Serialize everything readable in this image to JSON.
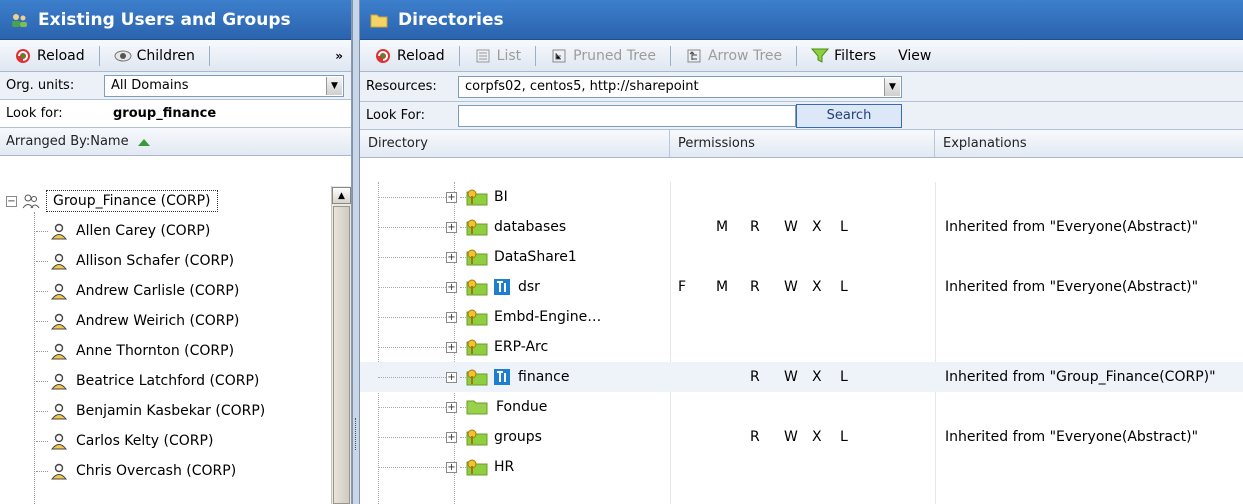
{
  "left_panel": {
    "title": "Existing Users and Groups",
    "toolbar": {
      "reload": "Reload",
      "children": "Children",
      "more": "»"
    },
    "org_units_label": "Org. units:",
    "org_units_value": "All Domains",
    "look_for_label": "Look for:",
    "look_for_value": "group_finance",
    "arranged_by": "Arranged By:Name",
    "tree": {
      "root": "Group_Finance (CORP)",
      "members": [
        "Allen Carey (CORP)",
        "Allison Schafer (CORP)",
        "Andrew Carlisle (CORP)",
        "Andrew Weirich (CORP)",
        "Anne Thornton (CORP)",
        "Beatrice Latchford (CORP)",
        "Benjamin Kasbekar (CORP)",
        "Carlos Kelty (CORP)",
        "Chris Overcash (CORP)"
      ]
    }
  },
  "right_panel": {
    "title": "Directories",
    "toolbar": {
      "reload": "Reload",
      "list": "List",
      "pruned_tree": "Pruned Tree",
      "arrow_tree": "Arrow Tree",
      "filters": "Filters",
      "view": "View"
    },
    "resources_label": "Resources:",
    "resources_value": "corpfs02, centos5, http://sharepoint",
    "look_for_label": "Look For:",
    "look_for_value": "",
    "search_button": "Search",
    "columns": {
      "directory": "Directory",
      "permissions": "Permissions",
      "explanations": "Explanations"
    },
    "rows": [
      {
        "name": "BI",
        "icon": "shared-folder-icon",
        "perms": [
          "",
          "",
          "",
          "",
          "",
          ""
        ],
        "explanation": ""
      },
      {
        "name": "databases",
        "icon": "shared-folder-icon",
        "perms": [
          "",
          "M",
          "R",
          "W",
          "X",
          "L"
        ],
        "explanation": "Inherited from \"Everyone(Abstract)\""
      },
      {
        "name": "DataShare1",
        "icon": "shared-folder-icon",
        "perms": [
          "",
          "",
          "",
          "",
          "",
          ""
        ],
        "explanation": ""
      },
      {
        "name": "dsr",
        "icon": "shared-folder-icon",
        "perms": [
          "F",
          "M",
          "R",
          "W",
          "X",
          "L"
        ],
        "explanation": "Inherited from \"Everyone(Abstract)\""
      },
      {
        "name": "Embd-Engine…",
        "icon": "shared-folder-icon",
        "perms": [
          "",
          "",
          "",
          "",
          "",
          ""
        ],
        "explanation": ""
      },
      {
        "name": "ERP-Arc",
        "icon": "shared-folder-icon",
        "perms": [
          "",
          "",
          "",
          "",
          "",
          ""
        ],
        "explanation": ""
      },
      {
        "name": "finance",
        "icon": "shared-folder-icon",
        "perms": [
          "",
          "",
          "R",
          "W",
          "X",
          "L"
        ],
        "explanation": "Inherited from \"Group_Finance(CORP)\""
      },
      {
        "name": "Fondue",
        "icon": "folder-icon",
        "perms": [
          "",
          "",
          "",
          "",
          "",
          ""
        ],
        "explanation": ""
      },
      {
        "name": "groups",
        "icon": "shared-folder-icon",
        "perms": [
          "",
          "",
          "R",
          "W",
          "X",
          "L"
        ],
        "explanation": "Inherited from \"Everyone(Abstract)\""
      },
      {
        "name": "HR",
        "icon": "shared-folder-icon",
        "perms": [
          "",
          "",
          "",
          "",
          "",
          ""
        ],
        "explanation": ""
      }
    ]
  },
  "colors": {
    "title_bar": "#2b63ae",
    "selection": "#eef3fa",
    "search_button": "#dce8f8"
  }
}
